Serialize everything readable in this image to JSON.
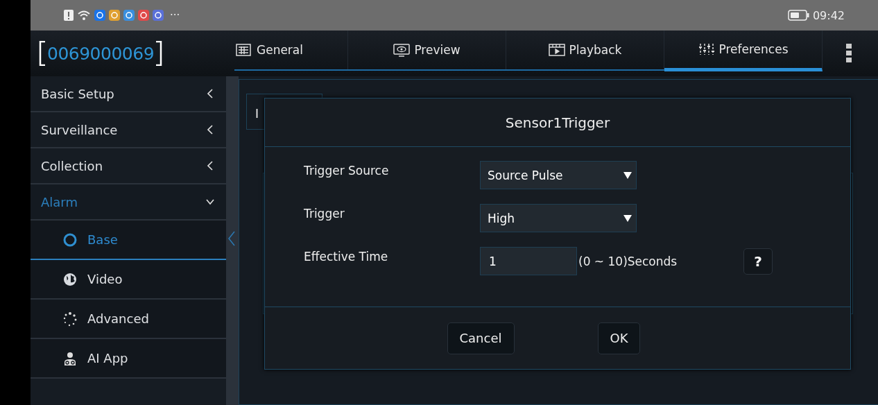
{
  "status_bar": {
    "more": "···",
    "time": "09:42"
  },
  "header": {
    "device_id": "0069000069",
    "tabs": [
      {
        "label": "General",
        "selected": false
      },
      {
        "label": "Preview",
        "selected": false
      },
      {
        "label": "Playback",
        "selected": false
      },
      {
        "label": "Preferences",
        "selected": true
      }
    ]
  },
  "sidebar": {
    "items": [
      {
        "label": "Basic Setup",
        "kind": "group",
        "expanded": false
      },
      {
        "label": "Surveillance",
        "kind": "group",
        "expanded": false
      },
      {
        "label": "Collection",
        "kind": "group",
        "expanded": false
      },
      {
        "label": "Alarm",
        "kind": "group",
        "expanded": true
      },
      {
        "label": "Base",
        "kind": "sub",
        "selected": true
      },
      {
        "label": "Video",
        "kind": "sub",
        "selected": false
      },
      {
        "label": "Advanced",
        "kind": "sub",
        "selected": false
      },
      {
        "label": "AI App",
        "kind": "sub",
        "selected": false
      }
    ]
  },
  "content": {
    "tab_label": "I"
  },
  "dialog": {
    "title": "Sensor1Trigger",
    "fields": [
      {
        "label": "Trigger Source",
        "kind": "select",
        "value": "Source Pulse"
      },
      {
        "label": "Trigger",
        "kind": "select",
        "value": "High"
      },
      {
        "label": "Effective Time",
        "kind": "number",
        "value": "1",
        "unit": "(0 ~ 10)Seconds",
        "help": "?"
      }
    ],
    "buttons": [
      "Cancel",
      "OK"
    ]
  }
}
